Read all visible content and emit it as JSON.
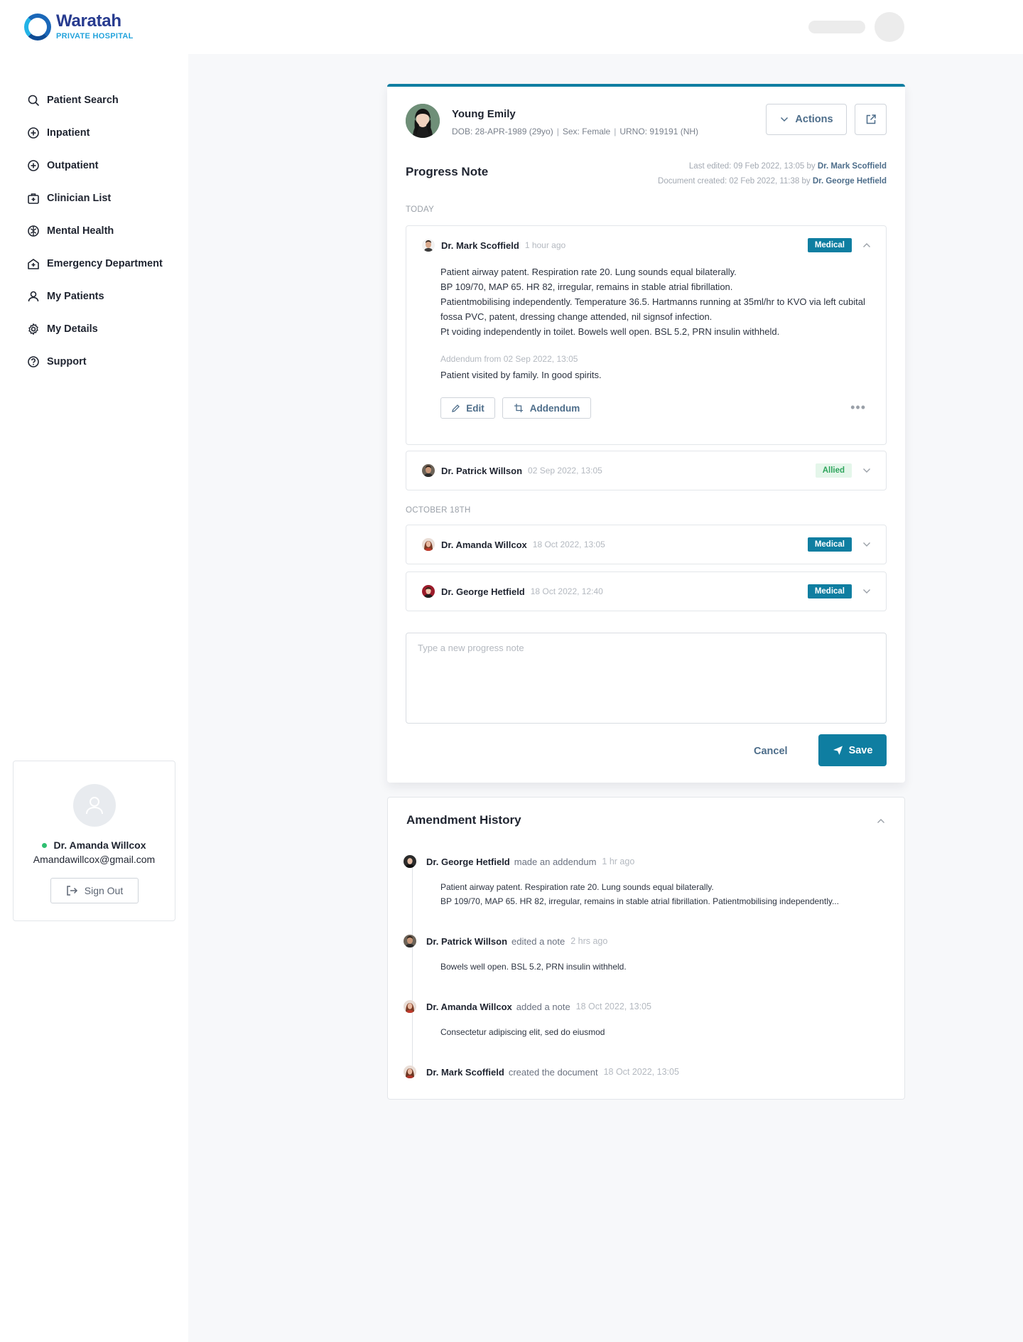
{
  "brand": {
    "name": "Waratah",
    "subtitle": "PRIVATE HOSPITAL",
    "color_primary": "#273b8f",
    "color_accent": "#23a3dc"
  },
  "sidebar": {
    "items": [
      {
        "label": "Patient Search",
        "icon": "search-icon"
      },
      {
        "label": "Inpatient",
        "icon": "plus-circle-icon"
      },
      {
        "label": "Outpatient",
        "icon": "plus-circle-icon"
      },
      {
        "label": "Clinician List",
        "icon": "medical-kit-icon"
      },
      {
        "label": "Mental Health",
        "icon": "brain-icon"
      },
      {
        "label": "Emergency Department",
        "icon": "hospital-icon"
      },
      {
        "label": "My Patients",
        "icon": "user-icon"
      },
      {
        "label": "My Details",
        "icon": "gear-icon"
      },
      {
        "label": "Support",
        "icon": "help-icon"
      }
    ],
    "profile": {
      "name": "Dr. Amanda Willcox",
      "email": "Amandawillcox@gmail.com",
      "signout": "Sign Out",
      "status_color": "#2fbf71"
    }
  },
  "patient": {
    "name": "Young Emily",
    "dob": "DOB: 28-APR-1989 (29yo)",
    "sex": "Sex: Female",
    "urno": "URNO: 919191 (NH)",
    "sep": "|",
    "actions_label": "Actions"
  },
  "note": {
    "title": "Progress Note",
    "last_edited_prefix": "Last edited: 09 Feb 2022, 13:05 by ",
    "last_edited_by": "Dr. Mark Scoffield",
    "created_prefix": "Document created: 02 Feb 2022, 11:38 by ",
    "created_by": "Dr. George Hetfield",
    "section_today": "TODAY",
    "section_october": "OCTOBER 18TH",
    "accent": "#0f7ea1"
  },
  "entries": [
    {
      "author": "Dr. Mark Scoffield",
      "time": "1 hour ago",
      "tag": "Medical",
      "lines": [
        "Patient airway patent. Respiration rate 20. Lung sounds equal bilaterally.",
        "BP 109/70, MAP 65. HR 82, irregular, remains in stable atrial fibrillation.",
        "Patientmobilising independently. Temperature 36.5. Hartmanns running at 35ml/hr to KVO via left cubital fossa PVC, patent, dressing change attended, nil signsof infection.",
        "Pt voiding independently in toilet. Bowels well open. BSL 5.2, PRN insulin withheld."
      ],
      "addendum_label": "Addendum from 02 Sep 2022, 13:05",
      "addendum_text": "Patient visited by family. In good spirits.",
      "edit_label": "Edit",
      "addendum_button": "Addendum",
      "more": "•••"
    },
    {
      "author": "Dr. Patrick Willson",
      "time": "02 Sep 2022, 13:05",
      "tag": "Allied"
    },
    {
      "author": "Dr. Amanda Willcox",
      "time": "18 Oct 2022, 13:05",
      "tag": "Medical"
    },
    {
      "author": "Dr. George Hetfield",
      "time": "18 Oct 2022, 12:40",
      "tag": "Medical"
    }
  ],
  "composer": {
    "placeholder": "Type a new progress note",
    "cancel": "Cancel",
    "save": "Save"
  },
  "history": {
    "title": "Amendment History",
    "items": [
      {
        "author": "Dr. George Hetfield",
        "action": "made an addendum",
        "time": "1 hr ago",
        "body": [
          "Patient airway patent. Respiration rate 20. Lung sounds equal bilaterally.",
          "BP 109/70, MAP 65. HR 82, irregular, remains in stable atrial fibrillation. Patientmobilising independently..."
        ]
      },
      {
        "author": "Dr. Patrick Willson",
        "action": "edited a note",
        "time": "2 hrs ago",
        "body": [
          "Bowels well open. BSL 5.2, PRN insulin withheld."
        ]
      },
      {
        "author": "Dr. Amanda Willcox",
        "action": "added a note",
        "time": "18 Oct 2022, 13:05",
        "body": [
          "Consectetur adipiscing elit, sed do eiusmod"
        ]
      },
      {
        "author": "Dr. Mark Scoffield",
        "action": "created the document",
        "time": "18 Oct 2022, 13:05",
        "body": []
      }
    ]
  }
}
